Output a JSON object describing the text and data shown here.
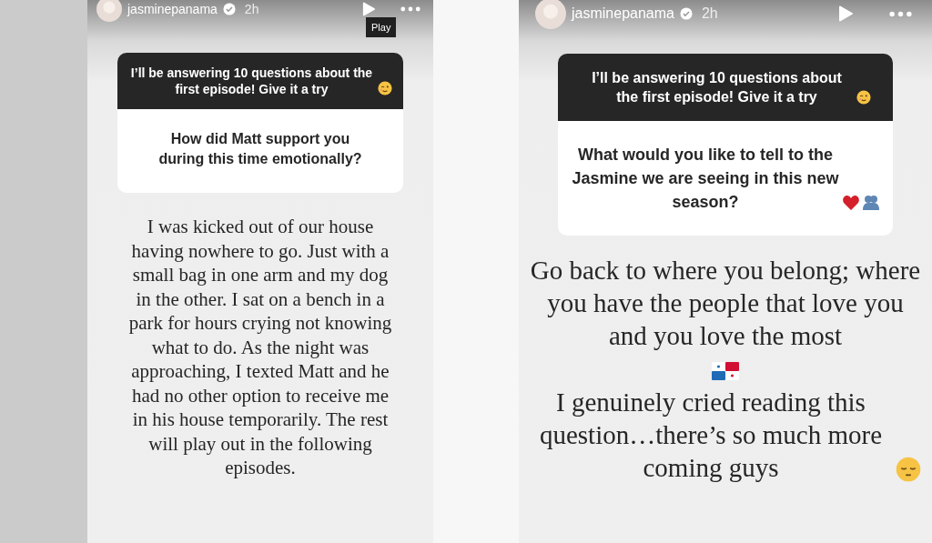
{
  "stories": [
    {
      "username": "jasminepanama",
      "time": "2h",
      "tooltip": "Play",
      "prompt": {
        "text": "I’ll be answering 10 questions about the first episode! Give it a try",
        "icons": [
          {
            "kind": "wink"
          }
        ]
      },
      "question": {
        "text": "How did Matt support you during this time emotionally?"
      },
      "answer": [
        {
          "kind": "text",
          "text": "I was kicked out of our house having nowhere to go. Just with a small bag in one arm and my dog in the other. I sat on a bench in a park for hours crying not knowing what to do. As the night was approaching, I texted Matt and he had no other option to receive me in his house temporarily. The rest will play out in the following episodes."
        }
      ]
    },
    {
      "username": "jasminepanama",
      "time": "2h",
      "prompt": {
        "text": "I’ll be answering 10 questions about the first episode! Give it a try",
        "icons": [
          {
            "kind": "wink"
          }
        ]
      },
      "question": {
        "text": "What would you like to tell to the Jasmine we are seeing in this new season?",
        "icons": [
          {
            "kind": "heart"
          },
          {
            "kind": "people"
          }
        ]
      },
      "answer": [
        {
          "kind": "text",
          "text": "Go back to where you belong; where you have the people that love you and you love the most"
        },
        {
          "kind": "flag"
        },
        {
          "kind": "text",
          "text": "I genuinely cried reading this question…there’s so much more coming guys",
          "icons": [
            {
              "kind": "pensive"
            }
          ]
        }
      ]
    }
  ]
}
